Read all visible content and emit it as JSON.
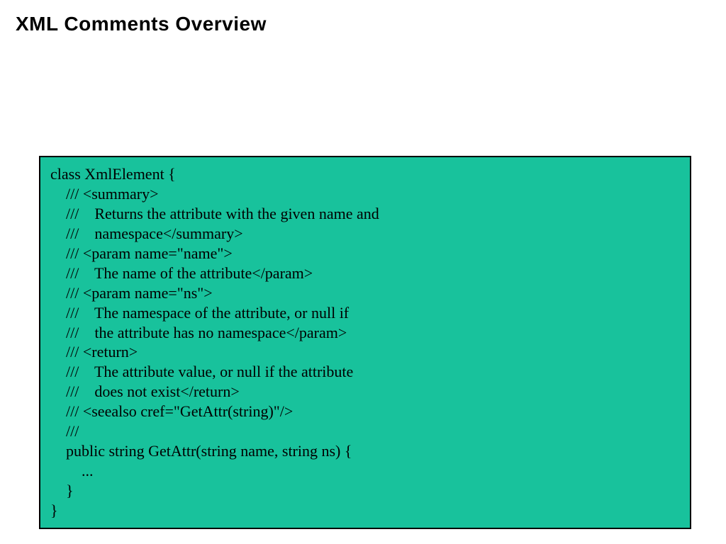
{
  "title": "XML Comments Overview",
  "code": {
    "lines": [
      "class XmlElement {",
      "    /// <summary>",
      "    ///    Returns the attribute with the given name and",
      "    ///    namespace</summary>",
      "    /// <param name=\"name\">",
      "    ///    The name of the attribute</param>",
      "    /// <param name=\"ns\">",
      "    ///    The namespace of the attribute, or null if",
      "    ///    the attribute has no namespace</param>",
      "    /// <return>",
      "    ///    The attribute value, or null if the attribute",
      "    ///    does not exist</return>",
      "    /// <seealso cref=\"GetAttr(string)\"/>",
      "    ///",
      "    public string GetAttr(string name, string ns) {",
      "        ...",
      "    }",
      "}"
    ]
  }
}
